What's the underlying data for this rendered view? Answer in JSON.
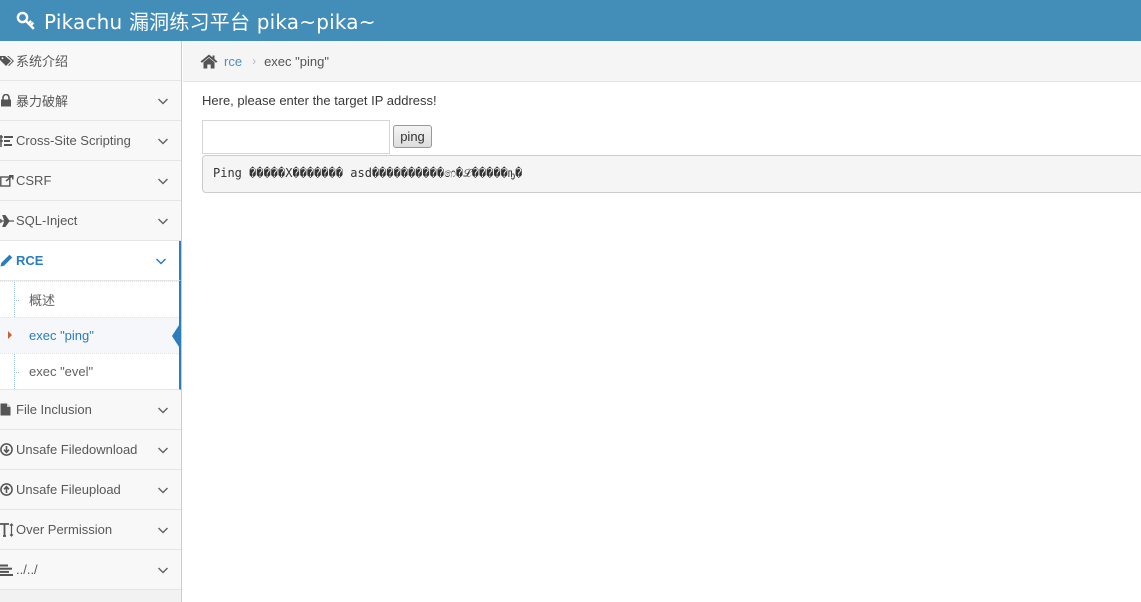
{
  "navbar": {
    "brand_icon": "key-icon",
    "title": "Pikachu 漏洞练习平台 pika~pika~"
  },
  "colors": {
    "navbar_bg": "#438eb9",
    "accent": "#2b7dbc",
    "caret": "#c86139"
  },
  "sidebar": {
    "items": [
      {
        "label": "系统介绍",
        "icon": "tags-icon",
        "chevron": false
      },
      {
        "label": "暴力破解",
        "icon": "lock-icon",
        "chevron": true
      },
      {
        "label": "Cross-Site Scripting",
        "icon": "sliders-icon",
        "chevron": true
      },
      {
        "label": "CSRF",
        "icon": "share-icon",
        "chevron": true
      },
      {
        "label": "SQL-Inject",
        "icon": "plane-icon",
        "chevron": true
      },
      {
        "label": "RCE",
        "icon": "pencil-icon",
        "chevron": true,
        "active": true
      },
      {
        "label": "File Inclusion",
        "icon": "file-icon",
        "chevron": true
      },
      {
        "label": "Unsafe Filedownload",
        "icon": "download-icon",
        "chevron": true
      },
      {
        "label": "Unsafe Fileupload",
        "icon": "upload-icon",
        "chevron": true
      },
      {
        "label": "Over Permission",
        "icon": "text-height-icon",
        "chevron": true
      },
      {
        "label": "../../",
        "icon": "align-left-icon",
        "chevron": true
      }
    ],
    "rce_submenu": [
      {
        "label": "概述"
      },
      {
        "label": "exec \"ping\"",
        "active": true
      },
      {
        "label": "exec \"evel\""
      }
    ]
  },
  "breadcrumb": {
    "home_icon": "home-icon",
    "link": "rce",
    "current": "exec \"ping\""
  },
  "main": {
    "prompt": "Here, please enter the target IP address!",
    "ip_input_value": "",
    "ping_label": "ping",
    "result_text": "Ping �����X������� asd����������෨�ℒ�����ҧ�"
  }
}
